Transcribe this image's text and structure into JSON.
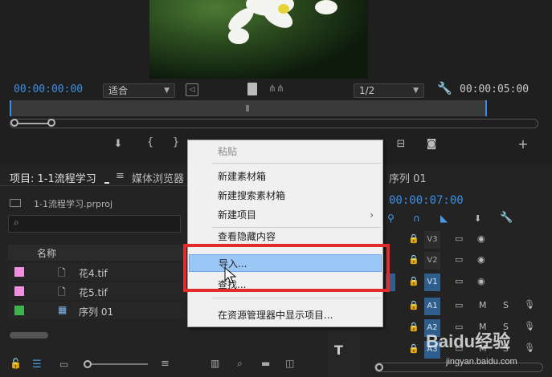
{
  "monitor": {
    "timecode_current": "00:00:00:00",
    "fit_select": "适合",
    "resolution_select": "1/2",
    "timecode_duration": "00:00:05:00"
  },
  "project": {
    "tab_label": "项目: 1-1流程学习",
    "tab_menu_icon": "hamburger-icon",
    "media_browser_tab": "媒体浏览器",
    "project_file": "1-1流程学习.prproj",
    "column_name": "名称",
    "items": [
      {
        "name": "花4.tif",
        "color": "#f08ee0",
        "icon": "image-file-icon"
      },
      {
        "name": "花5.tif",
        "color": "#f08ee0",
        "icon": "image-file-icon"
      },
      {
        "name": "序列 01",
        "color": "#3fb34f",
        "icon": "sequence-icon"
      }
    ]
  },
  "timeline": {
    "tab_label": "序列 01",
    "timecode": "00:00:07:00",
    "video_tracks": [
      "V3",
      "V2",
      "V1"
    ],
    "audio_tracks": [
      "A1",
      "A2",
      "A3"
    ],
    "track_v1_label": "V1",
    "mute_label": "M",
    "solo_label": "S",
    "tool_text": "T"
  },
  "menu": {
    "paste": "粘贴",
    "new_bin": "新建素材箱",
    "new_search_bin": "新建搜索素材箱",
    "new_item": "新建项目",
    "view_hidden": "查看隐藏内容",
    "import": "导入...",
    "find": "查找...",
    "reveal": "在资源管理器中显示项目..."
  },
  "watermark": {
    "text": "Baidu经验",
    "url": "jingyan.baidu.com"
  }
}
